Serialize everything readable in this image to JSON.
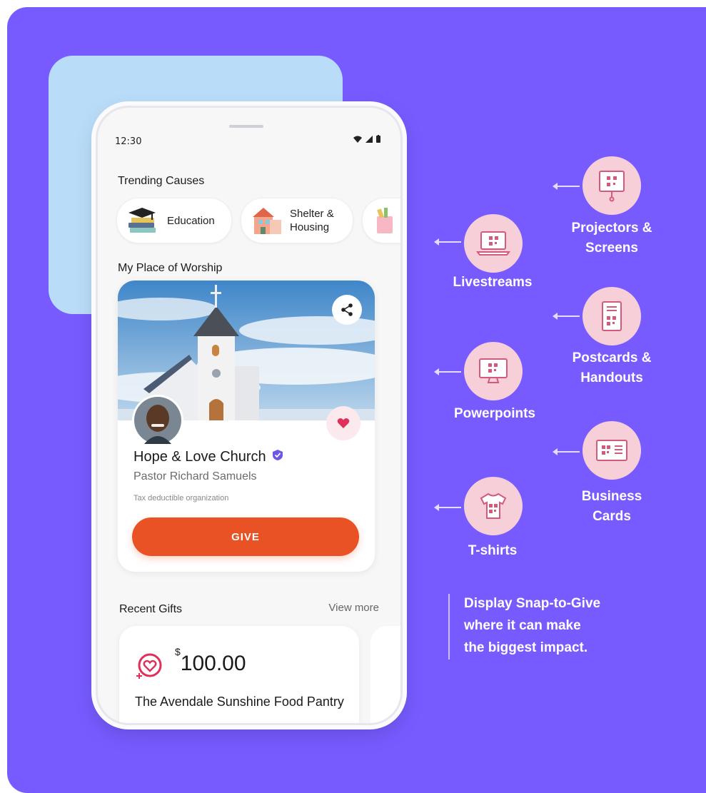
{
  "status_bar": {
    "time": "12:30"
  },
  "trending": {
    "title": "Trending Causes",
    "causes": [
      {
        "label": "Education",
        "icon": "graduation-books-icon"
      },
      {
        "label": "Shelter &\nHousing",
        "icon": "house-icon"
      }
    ]
  },
  "worship": {
    "title": "My Place of Worship",
    "church_name": "Hope & Love Church",
    "pastor": "Pastor Richard Samuels",
    "tax_note": "Tax deductible organization",
    "give_label": "GIVE"
  },
  "recent_gifts": {
    "title": "Recent Gifts",
    "view_more": "View more",
    "currency": "$",
    "amount": "100.00",
    "organization": "The Avendale Sunshine Food Pantry"
  },
  "uses": [
    {
      "label": "Projectors &\nScreens",
      "icon": "projector-qr-icon"
    },
    {
      "label": "Livestreams",
      "icon": "laptop-qr-icon"
    },
    {
      "label": "Postcards &\nHandouts",
      "icon": "postcard-qr-icon"
    },
    {
      "label": "Powerpoints",
      "icon": "monitor-qr-icon"
    },
    {
      "label": "Business\nCards",
      "icon": "business-card-qr-icon"
    },
    {
      "label": "T-shirts",
      "icon": "tshirt-qr-icon"
    }
  ],
  "tagline": "Display Snap-to-Give\nwhere it can make\nthe biggest impact.",
  "colors": {
    "background": "#775bff",
    "give_button": "#e85224",
    "icon_circle": "#f6cfd8"
  }
}
